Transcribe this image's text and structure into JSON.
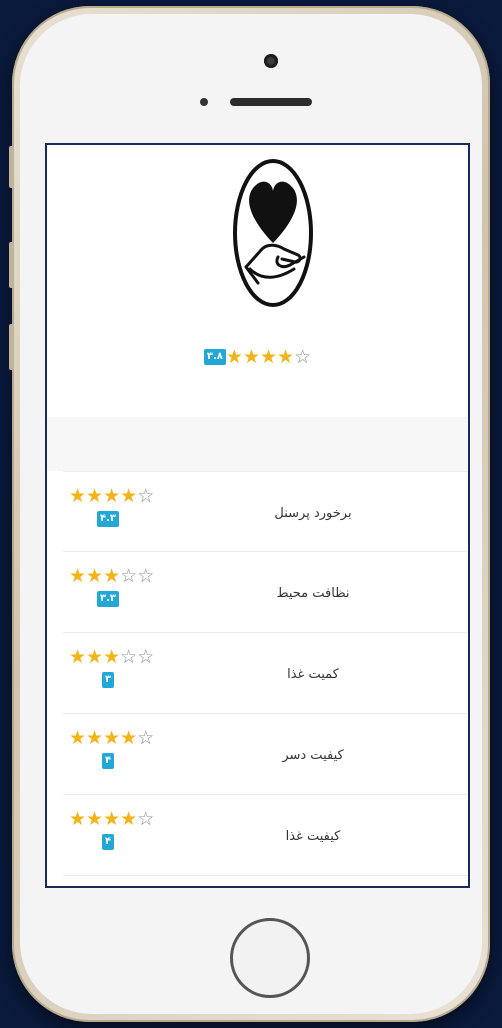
{
  "overall": {
    "score": "۳.۸",
    "stars": [
      1,
      1,
      1,
      1,
      0
    ]
  },
  "ratings": [
    {
      "label": "برخورد پرسنل",
      "score": "۴.۳",
      "stars": [
        1,
        1,
        1,
        1,
        0
      ]
    },
    {
      "label": "نظافت محیط",
      "score": "۳.۳",
      "stars": [
        1,
        1,
        1,
        0,
        0
      ]
    },
    {
      "label": "کمیت غذا",
      "score": "۳",
      "stars": [
        1,
        1,
        1,
        0,
        0
      ]
    },
    {
      "label": "کیفیت دسر",
      "score": "۴",
      "stars": [
        1,
        1,
        1,
        1,
        0
      ]
    },
    {
      "label": "کیفیت غذا",
      "score": "۴",
      "stars": [
        1,
        1,
        1,
        1,
        0
      ]
    }
  ],
  "colors": {
    "star_on": "#f2b417",
    "star_off": "#8890a0",
    "badge": "#22a7d6",
    "frame": "#1b2a56"
  },
  "icons": {
    "logo": "heart-in-hand-icon",
    "filled_star": "star-icon",
    "empty_star": "star-outline-icon"
  }
}
